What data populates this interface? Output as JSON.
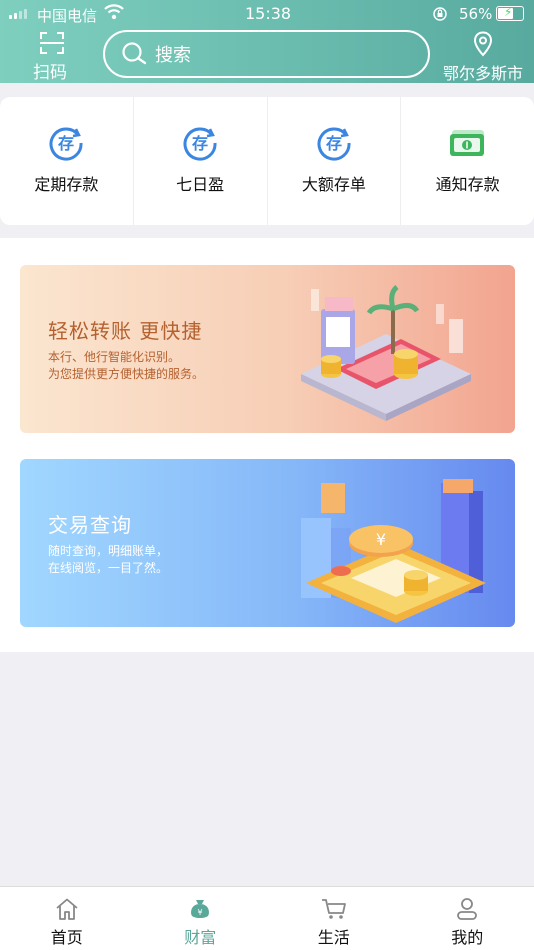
{
  "status_bar": {
    "carrier": "中国电信",
    "time": "15:38",
    "battery": "56%"
  },
  "header": {
    "scan_label": "扫码",
    "search_placeholder": "搜索",
    "location": "鄂尔多斯市"
  },
  "quick_menu": [
    {
      "label": "定期存款",
      "icon": "deposit-icon"
    },
    {
      "label": "七日盈",
      "icon": "deposit-icon"
    },
    {
      "label": "大额存单",
      "icon": "deposit-icon"
    },
    {
      "label": "通知存款",
      "icon": "cash-icon"
    }
  ],
  "banners": [
    {
      "title": "轻松转账 更快捷",
      "subtitle_line1": "本行、他行智能化识别。",
      "subtitle_line2": "为您提供更方便快捷的服务。"
    },
    {
      "title": "交易查询",
      "subtitle_line1": "随时查询，明细账单，",
      "subtitle_line2": "在线阅览，一目了然。"
    }
  ],
  "tab_bar": [
    {
      "label": "首页",
      "icon": "home-icon",
      "active": false
    },
    {
      "label": "财富",
      "icon": "money-bag-icon",
      "active": true
    },
    {
      "label": "生活",
      "icon": "cart-icon",
      "active": false
    },
    {
      "label": "我的",
      "icon": "user-icon",
      "active": false
    }
  ],
  "colors": {
    "accent": "#5aa89a",
    "header_start": "#7fcfbf",
    "header_end": "#58aa9f",
    "deposit_icon": "#3b86e0"
  }
}
